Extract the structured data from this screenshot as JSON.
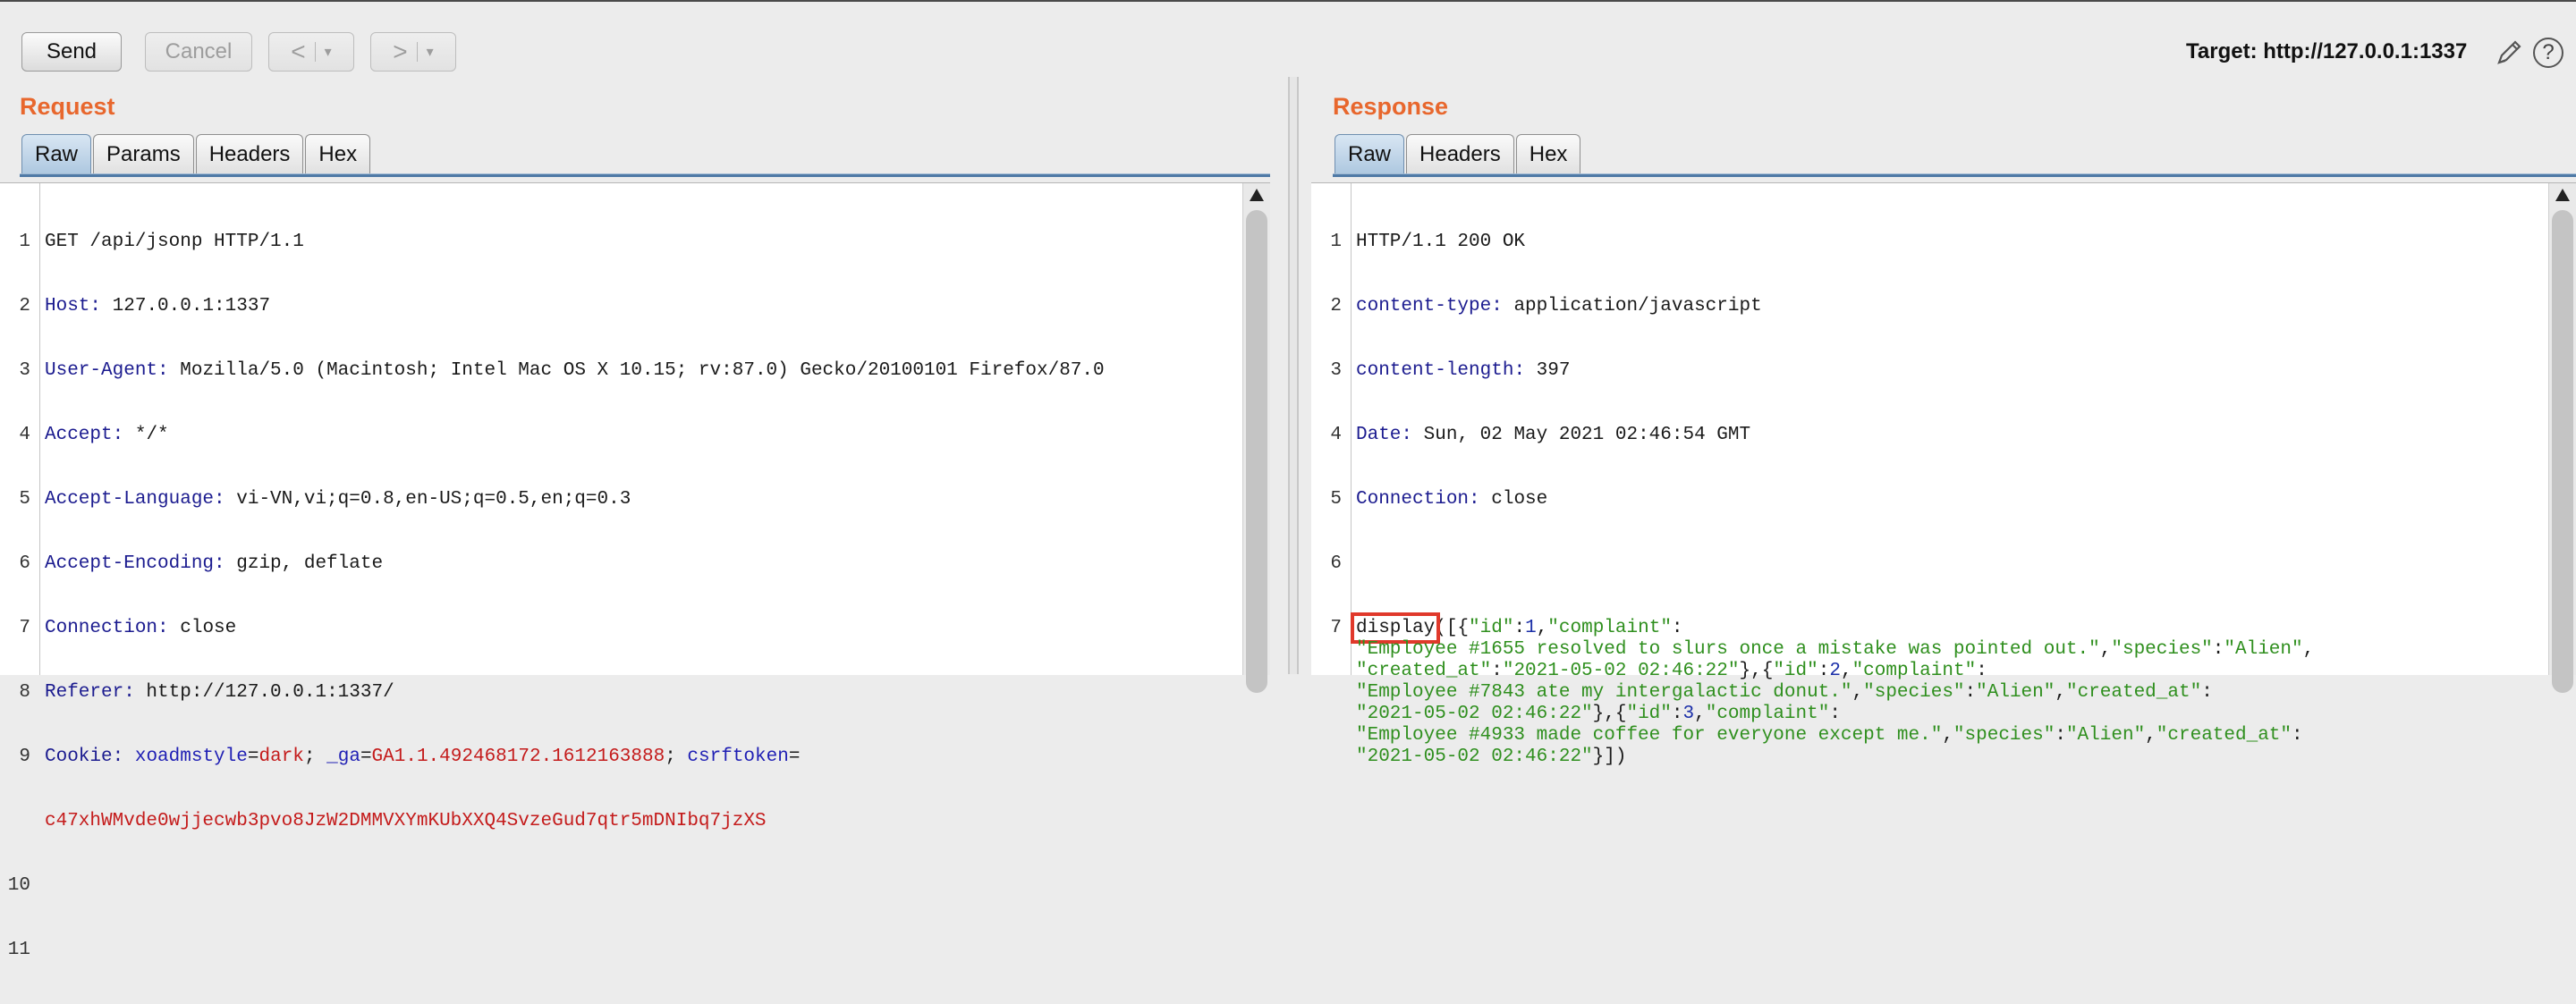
{
  "toolbar": {
    "send": "Send",
    "cancel": "Cancel",
    "back_arrow": "<",
    "forward_arrow": ">",
    "dropdown": "▾",
    "target": "Target: http://127.0.0.1:1337",
    "help": "?"
  },
  "request": {
    "title": "Request",
    "tabs": [
      "Raw",
      "Params",
      "Headers",
      "Hex"
    ],
    "active_tab": "Raw",
    "lines": [
      {
        "n": "1",
        "plain": "GET /api/jsonp HTTP/1.1"
      },
      {
        "n": "2",
        "key": "Host",
        "val": " 127.0.0.1:1337"
      },
      {
        "n": "3",
        "key": "User-Agent",
        "val": " Mozilla/5.0 (Macintosh; Intel Mac OS X 10.15; rv:87.0) Gecko/20100101 Firefox/87.0"
      },
      {
        "n": "4",
        "key": "Accept",
        "val": " */*"
      },
      {
        "n": "5",
        "key": "Accept-Language",
        "val": " vi-VN,vi;q=0.8,en-US;q=0.5,en;q=0.3"
      },
      {
        "n": "6",
        "key": "Accept-Encoding",
        "val": " gzip, deflate"
      },
      {
        "n": "7",
        "key": "Connection",
        "val": " close"
      },
      {
        "n": "8",
        "key": "Referer",
        "val": " http://127.0.0.1:1337/"
      },
      {
        "n": "9",
        "key": "Cookie",
        "cookies": {
          "c1_name": "xoadmstyle",
          "c1_val": "dark",
          "c2_name": "_ga",
          "c2_val": "GA1.1.492468172.1612163888",
          "c3_name": "csrftoken",
          "c3_val": "c47xhWMvde0wjjecwb3pvo8JzW2DMMVXYmKUbXXQ4SvzeGud7qtr5mDNIbq7jzXS"
        }
      },
      {
        "n": "10",
        "plain": ""
      },
      {
        "n": "11",
        "plain": ""
      }
    ]
  },
  "response": {
    "title": "Response",
    "tabs": [
      "Raw",
      "Headers",
      "Hex"
    ],
    "active_tab": "Raw",
    "lines": [
      {
        "n": "1",
        "plain": "HTTP/1.1 200 OK"
      },
      {
        "n": "2",
        "key": "content-type",
        "val": " application/javascript"
      },
      {
        "n": "3",
        "key": "content-length",
        "val": " 397"
      },
      {
        "n": "4",
        "key": "Date",
        "val": " Sun, 02 May 2021 02:46:54 GMT"
      },
      {
        "n": "5",
        "key": "Connection",
        "val": " close"
      },
      {
        "n": "6",
        "plain": ""
      }
    ],
    "body": {
      "n": "7",
      "callback": "display",
      "rows": [
        [
          [
            "p",
            "("
          ],
          [
            "p",
            "[{"
          ],
          [
            "s",
            "\"id\""
          ],
          [
            "p",
            ":"
          ],
          [
            "n",
            "1"
          ],
          [
            "p",
            ","
          ],
          [
            "s",
            "\"complaint\""
          ],
          [
            "p",
            ":"
          ]
        ],
        [
          [
            "s",
            "\"Employee #1655 resolved to slurs once a mistake was pointed out.\""
          ],
          [
            "p",
            ","
          ],
          [
            "s",
            "\"species\""
          ],
          [
            "p",
            ":"
          ],
          [
            "s",
            "\"Alien\""
          ],
          [
            "p",
            ","
          ]
        ],
        [
          [
            "s",
            "\"created_at\""
          ],
          [
            "p",
            ":"
          ],
          [
            "s",
            "\"2021-05-02 02:46:22\""
          ],
          [
            "p",
            "},{"
          ],
          [
            "s",
            "\"id\""
          ],
          [
            "p",
            ":"
          ],
          [
            "n",
            "2"
          ],
          [
            "p",
            ","
          ],
          [
            "s",
            "\"complaint\""
          ],
          [
            "p",
            ":"
          ]
        ],
        [
          [
            "s",
            "\"Employee #7843 ate my intergalactic donut.\""
          ],
          [
            "p",
            ","
          ],
          [
            "s",
            "\"species\""
          ],
          [
            "p",
            ":"
          ],
          [
            "s",
            "\"Alien\""
          ],
          [
            "p",
            ","
          ],
          [
            "s",
            "\"created_at\""
          ],
          [
            "p",
            ":"
          ]
        ],
        [
          [
            "s",
            "\"2021-05-02 02:46:22\""
          ],
          [
            "p",
            "},{"
          ],
          [
            "s",
            "\"id\""
          ],
          [
            "p",
            ":"
          ],
          [
            "n",
            "3"
          ],
          [
            "p",
            ","
          ],
          [
            "s",
            "\"complaint\""
          ],
          [
            "p",
            ":"
          ]
        ],
        [
          [
            "s",
            "\"Employee #4933 made coffee for everyone except me.\""
          ],
          [
            "p",
            ","
          ],
          [
            "s",
            "\"species\""
          ],
          [
            "p",
            ":"
          ],
          [
            "s",
            "\"Alien\""
          ],
          [
            "p",
            ","
          ],
          [
            "s",
            "\"created_at\""
          ],
          [
            "p",
            ":"
          ]
        ],
        [
          [
            "s",
            "\"2021-05-02 02:46:22\""
          ],
          [
            "p",
            "}])"
          ]
        ]
      ]
    }
  },
  "colors": {
    "title_orange": "#e8672d",
    "header_key": "#1b1b8f",
    "string_green": "#2f8f1e",
    "highlight_box": "#e0392b"
  }
}
